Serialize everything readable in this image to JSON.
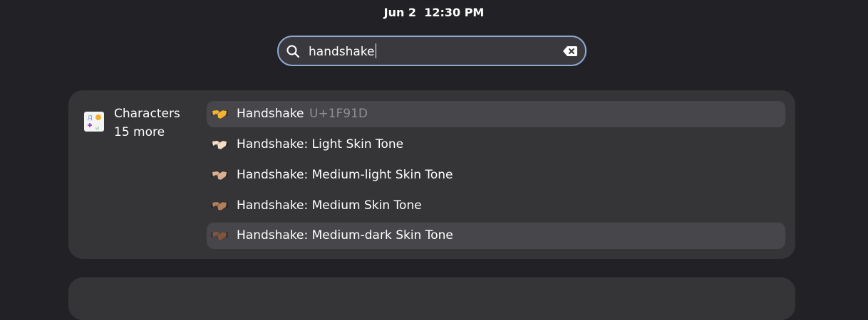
{
  "clock": "Jun 2  12:30 PM",
  "search": {
    "query": "handshake",
    "search_icon": "search-icon",
    "clear_icon": "backspace-clear-icon"
  },
  "provider": {
    "name": "Characters",
    "more": "15 more",
    "icon": "characters-app-icon"
  },
  "results": [
    {
      "label": "Handshake",
      "code": "U+1F91D",
      "emoji": "handshake-icon",
      "skin": "#f2b233",
      "highlighted": true
    },
    {
      "label": "Handshake: Light Skin Tone",
      "code": "",
      "emoji": "handshake-light-skin-tone-icon",
      "skin": "#f6dcc4",
      "highlighted": false
    },
    {
      "label": "Handshake: Medium-light Skin Tone",
      "code": "",
      "emoji": "handshake-medium-light-skin-tone-icon",
      "skin": "#d8b090",
      "highlighted": false
    },
    {
      "label": "Handshake: Medium Skin Tone",
      "code": "",
      "emoji": "handshake-medium-skin-tone-icon",
      "skin": "#b07f5c",
      "highlighted": false
    },
    {
      "label": "Handshake: Medium-dark Skin Tone",
      "code": "",
      "emoji": "handshake-medium-dark-skin-tone-icon",
      "skin": "#7e5640",
      "highlighted": true
    }
  ],
  "colors": {
    "background": "#222226",
    "panel": "#353538",
    "highlight": "#47474b",
    "focus_border": "#8fa9d4",
    "code_text": "#8e8e93"
  }
}
